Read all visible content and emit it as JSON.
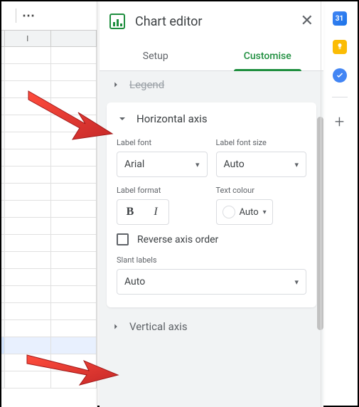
{
  "toolbar": {
    "more": "⋯"
  },
  "sheet": {
    "colI": "I"
  },
  "editor": {
    "title": "Chart editor",
    "tabs": {
      "setup": "Setup",
      "customise": "Customise"
    },
    "sections": {
      "legend": "Legend",
      "horizontal_axis": "Horizontal axis",
      "vertical_axis": "Vertical axis"
    },
    "horizontal": {
      "label_font": {
        "label": "Label font",
        "value": "Arial"
      },
      "label_font_size": {
        "label": "Label font size",
        "value": "Auto"
      },
      "label_format": {
        "label": "Label format",
        "bold": "B",
        "italic": "I"
      },
      "text_colour": {
        "label": "Text colour",
        "value": "Auto"
      },
      "reverse": "Reverse axis order",
      "slant": {
        "label": "Slant labels",
        "value": "Auto"
      }
    }
  },
  "sidebar": {
    "cal": "31",
    "plus": "+"
  }
}
